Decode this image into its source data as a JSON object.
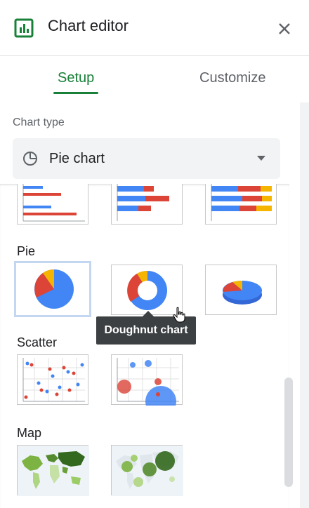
{
  "header": {
    "title": "Chart editor",
    "icon": "chart-icon",
    "close_icon": "close-icon"
  },
  "tabs": [
    {
      "label": "Setup",
      "active": true
    },
    {
      "label": "Customize",
      "active": false
    }
  ],
  "chart_type": {
    "label": "Chart type",
    "selected": "Pie chart",
    "icon": "pie-chart-icon"
  },
  "groups": [
    {
      "label": "Pie",
      "items": [
        "pie-chart",
        "doughnut-chart",
        "3d-pie-chart"
      ]
    },
    {
      "label": "Scatter",
      "items": [
        "scatter-chart",
        "bubble-chart"
      ]
    },
    {
      "label": "Map",
      "items": [
        "geo-chart",
        "geo-chart-markers"
      ]
    }
  ],
  "tooltip": {
    "text": "Doughnut chart"
  },
  "colors": {
    "accent": "#188038",
    "blue": "#4285f4",
    "red": "#db4437",
    "orange": "#f4b400"
  }
}
